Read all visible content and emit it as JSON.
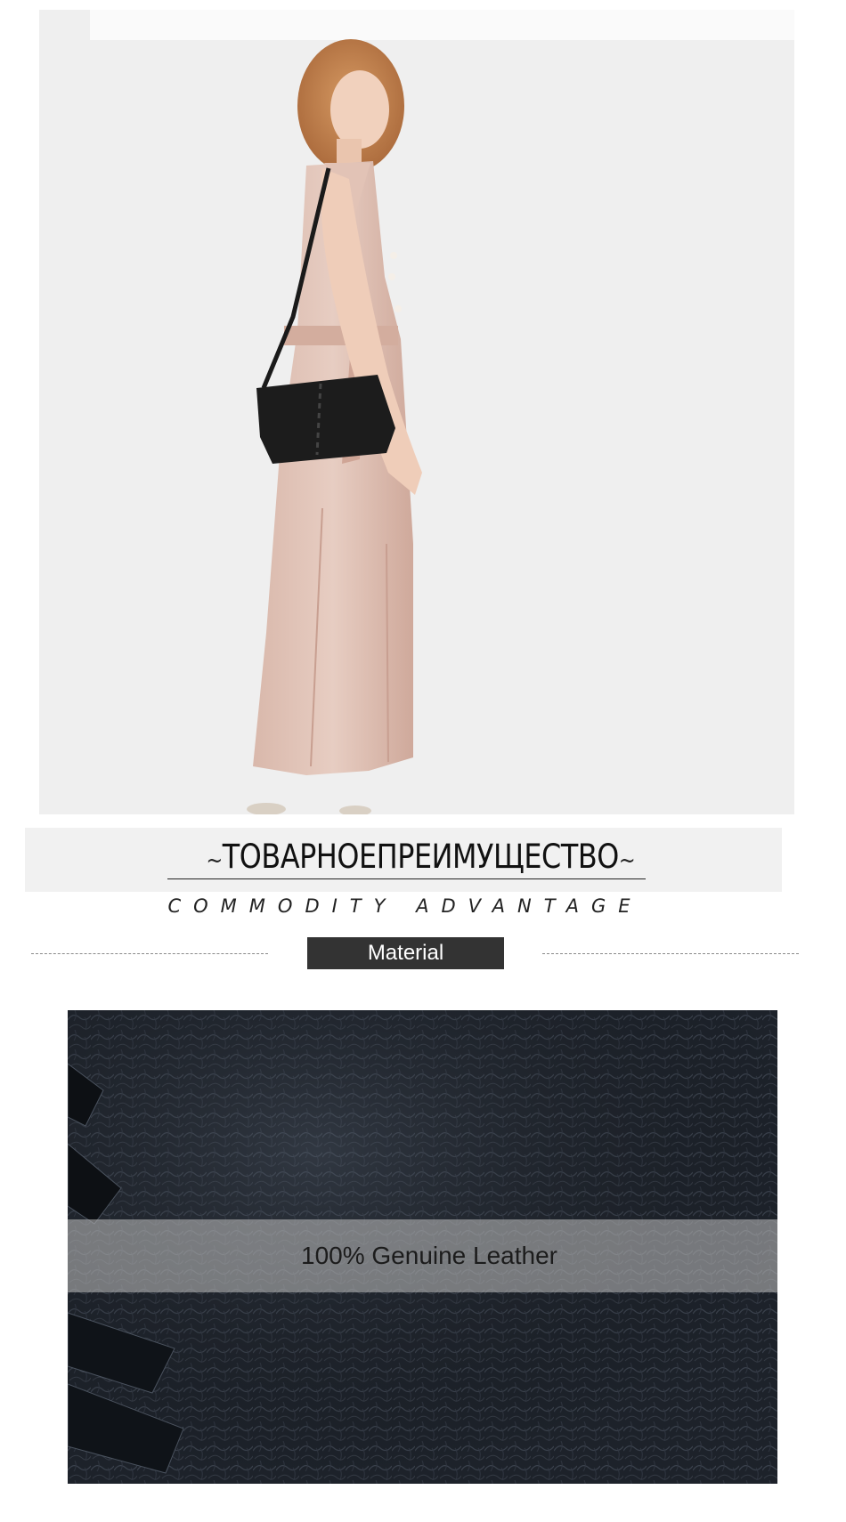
{
  "photo": {
    "alt_icon": "model-with-black-crossbody-bag"
  },
  "headline": {
    "ornament_left": "~",
    "title": "ТОВАРНОЕПРЕИМУЩЕСТВО",
    "ornament_right": "~",
    "subtitle": "COMMODITY ADVANTAGE"
  },
  "section": {
    "label": "Material"
  },
  "detail": {
    "caption": "100% Genuine Leather"
  },
  "colors": {
    "label_background": "#333333",
    "photo_background": "#efefef",
    "leather": "#1b1f26"
  }
}
